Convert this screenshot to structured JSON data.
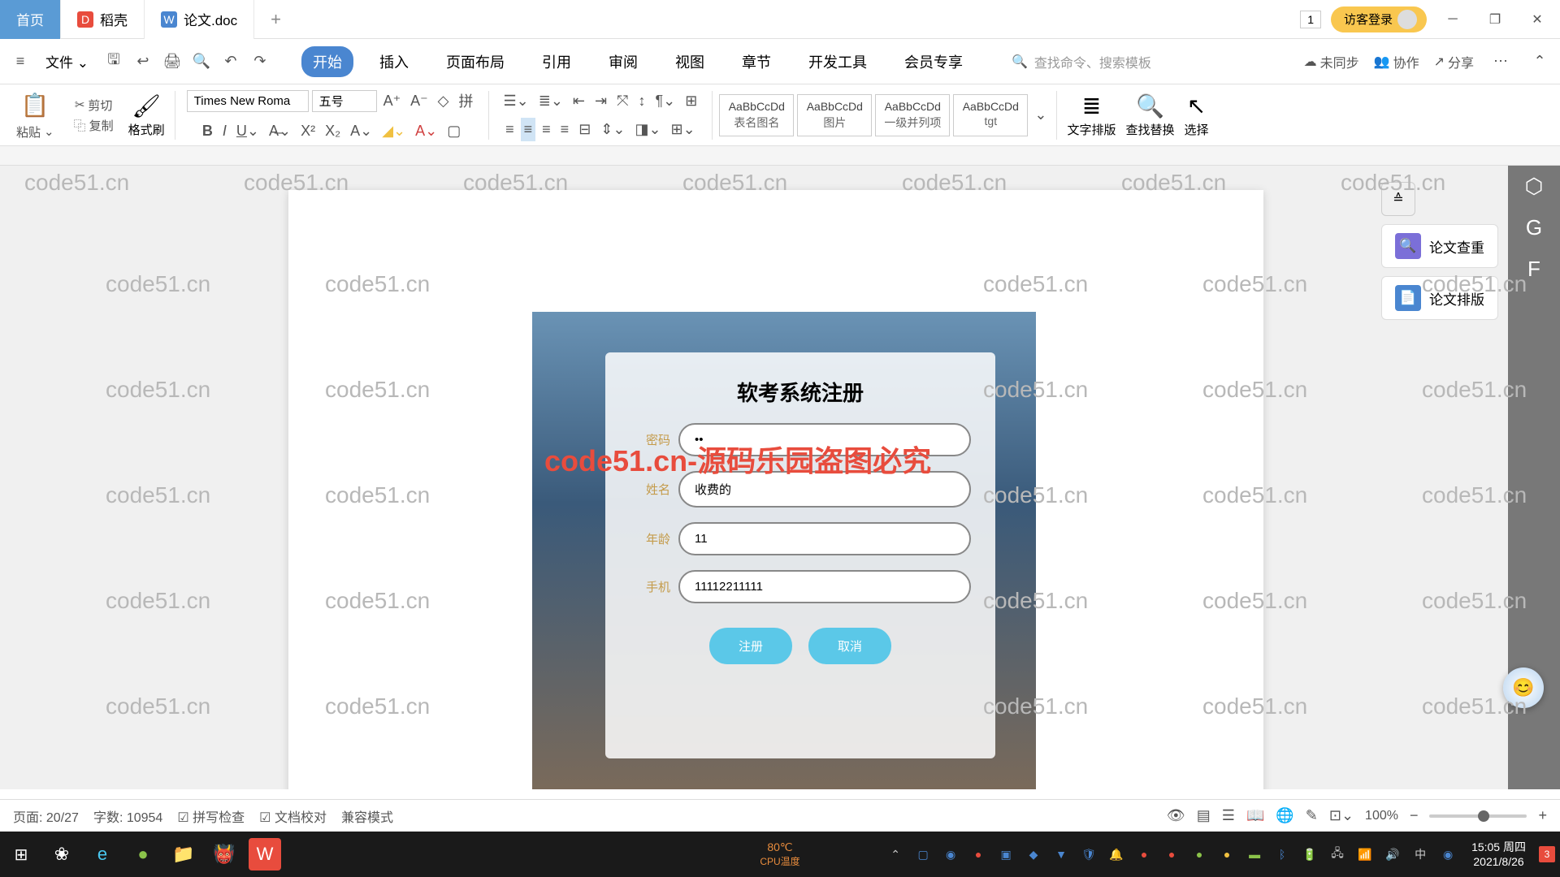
{
  "titlebar": {
    "tabs": [
      {
        "label": "首页",
        "icon": ""
      },
      {
        "label": "稻壳",
        "icon": "D"
      },
      {
        "label": "论文.doc",
        "icon": "W"
      }
    ],
    "num": "1",
    "guest": "访客登录"
  },
  "menubar": {
    "file": "文件",
    "tabs": [
      "开始",
      "插入",
      "页面布局",
      "引用",
      "审阅",
      "视图",
      "章节",
      "开发工具",
      "会员专享"
    ],
    "search_placeholder": "查找命令、搜索模板",
    "unsync": "未同步",
    "collab": "协作",
    "share": "分享"
  },
  "ribbon": {
    "paste": "粘贴",
    "cut": "剪切",
    "copy": "复制",
    "format_painter": "格式刷",
    "font_name": "Times New Roma",
    "font_size": "五号",
    "styles": [
      {
        "preview": "AaBbCcDd",
        "name": "表名图名"
      },
      {
        "preview": "AaBbCcDd",
        "name": "图片"
      },
      {
        "preview": "AaBbCcDd",
        "name": "一级并列项"
      },
      {
        "preview": "AaBbCcDd",
        "name": "tgt"
      }
    ],
    "text_layout": "文字排版",
    "find_replace": "查找替换",
    "select": "选择"
  },
  "side": {
    "check": "论文查重",
    "typeset": "论文排版"
  },
  "doc": {
    "form_title": "软考系统注册",
    "watermark_red": "code51.cn-源码乐园盗图必究",
    "labels": {
      "pwd": "密码",
      "name": "姓名",
      "age": "年龄",
      "phone": "手机"
    },
    "values": {
      "pwd": "••",
      "name": "收费的",
      "age": "11",
      "phone": "11112211111"
    },
    "btn_register": "注册",
    "btn_cancel": "取消"
  },
  "statusbar": {
    "page": "页面: 20/27",
    "words": "字数: 10954",
    "spell": "拼写检查",
    "proof": "文档校对",
    "compat": "兼容模式",
    "zoom": "100%"
  },
  "taskbar": {
    "temp": "80℃",
    "temp_label": "CPU温度",
    "time": "15:05",
    "day": "周四",
    "date": "2021/8/26",
    "notif": "3"
  },
  "watermark": "code51.cn"
}
